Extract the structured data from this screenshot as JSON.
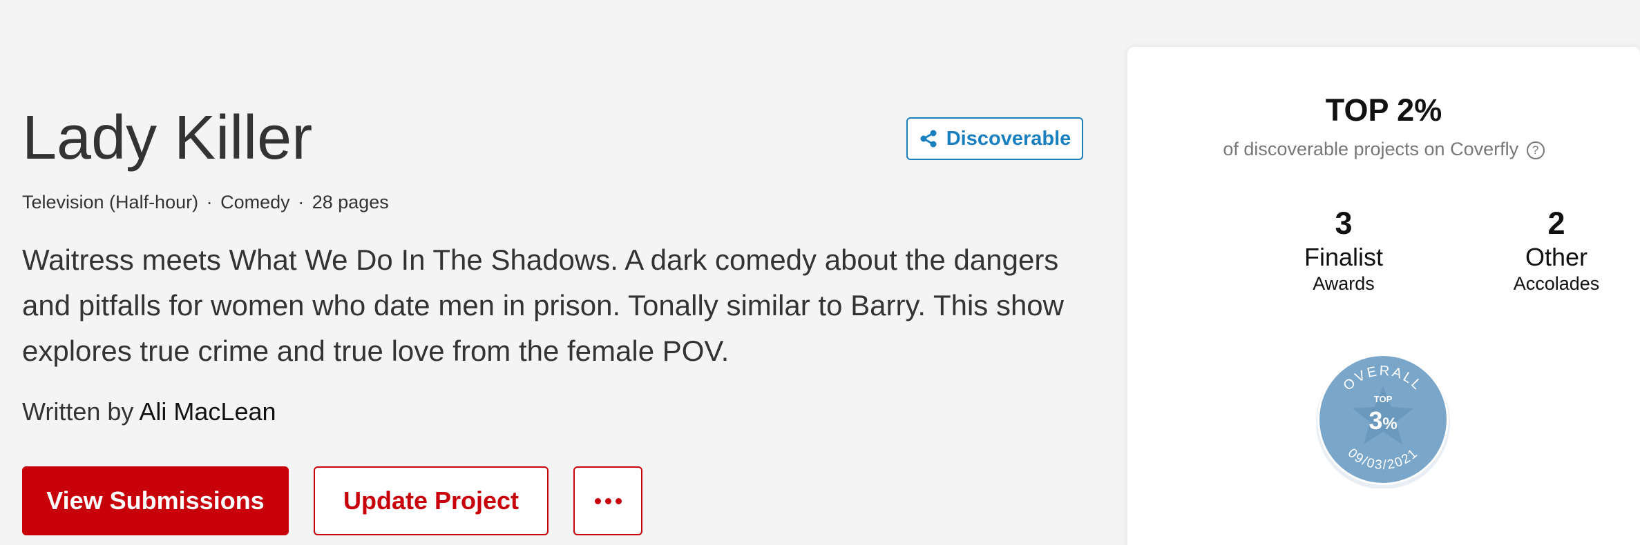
{
  "project": {
    "title": "Lady Killer",
    "format": "Television (Half-hour)",
    "genre": "Comedy",
    "pages": "28 pages",
    "separator": "·",
    "logline": "Waitress meets What We Do In The Shadows. A dark comedy about the dangers and pitfalls for women who date men in prison. Tonally similar to Barry. This show explores true crime and true love from the female POV.",
    "written_by_label": "Written by",
    "author": "Ali MacLean"
  },
  "discoverable": {
    "label": "Discoverable",
    "icon": "share-icon",
    "color": "#1a7fbf"
  },
  "actions": {
    "view_submissions": "View Submissions",
    "update_project": "Update Project",
    "more_icon": "more-horizontal-icon",
    "accent": "#c8000a"
  },
  "ranking": {
    "headline": "TOP 2%",
    "subtitle": "of discoverable projects on Coverfly",
    "help_icon": "question-circle-icon",
    "help_glyph": "?"
  },
  "stats": [
    {
      "value": "3",
      "label": "Finalist",
      "sublabel": "Awards"
    },
    {
      "value": "2",
      "label": "Other",
      "sublabel": "Accolades"
    }
  ],
  "badge": {
    "top_text": "OVERALL",
    "small_label": "TOP",
    "value": "3",
    "unit": "%",
    "date": "09/03/2021",
    "color": "#7aa6c9"
  }
}
